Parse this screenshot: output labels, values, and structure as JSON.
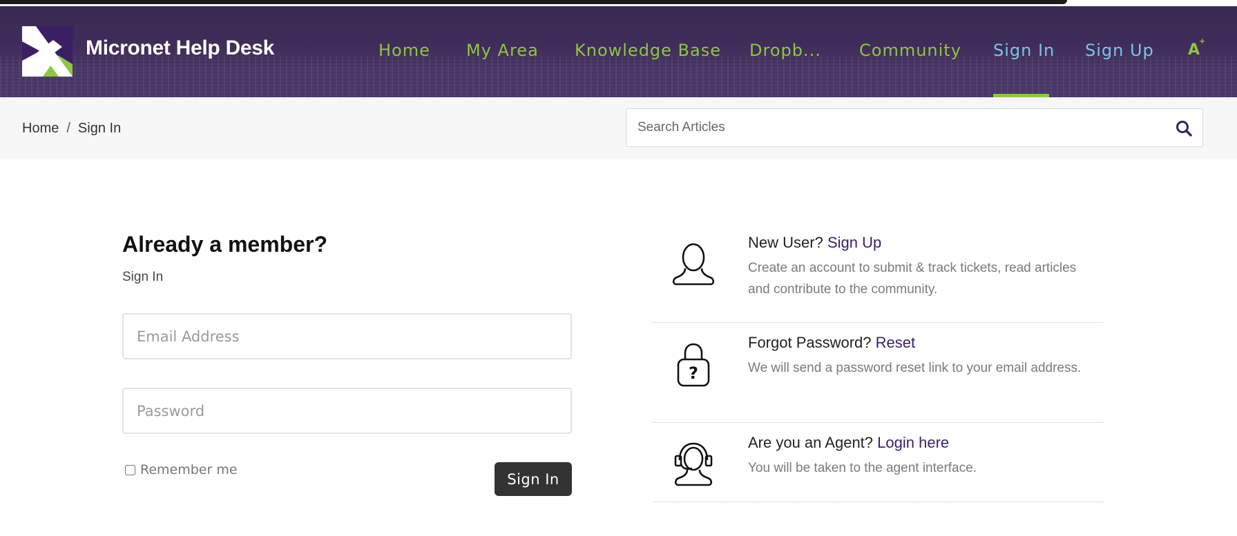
{
  "brand": {
    "name": "Micronet Help Desk"
  },
  "nav": {
    "items": [
      {
        "label": "Home",
        "color": "#8fc640"
      },
      {
        "label": "My Area",
        "color": "#8fc640"
      },
      {
        "label": "Knowledge Base",
        "color": "#8fc640"
      },
      {
        "label": "Dropb...",
        "color": "#8fc640"
      },
      {
        "label": "Community",
        "color": "#8fc640"
      },
      {
        "label": "Sign In",
        "color": "#7ec3e8",
        "active": true
      },
      {
        "label": "Sign Up",
        "color": "#7ec3e8"
      }
    ],
    "font_toggle": "A",
    "font_toggle_sup": "+"
  },
  "breadcrumb": {
    "home": "Home",
    "separator": "/",
    "current": "Sign In"
  },
  "search": {
    "placeholder": "Search Articles",
    "value": ""
  },
  "login": {
    "title": "Already a member?",
    "subtitle": "Sign In",
    "email_placeholder": "Email Address",
    "password_placeholder": "Password",
    "remember_label": "Remember me",
    "remember_checked": false,
    "submit_label": "Sign In"
  },
  "info": {
    "new_user": {
      "prefix": "New User?",
      "link": "Sign Up",
      "desc": "Create an account to submit & track tickets, read articles and contribute to the community.",
      "icon": "user-icon"
    },
    "forgot": {
      "prefix": "Forgot Password?",
      "link": "Reset",
      "desc": "We will send a password reset link to your email address.",
      "icon": "lock-question-icon"
    },
    "agent": {
      "prefix": "Are you an Agent?",
      "link": "Login here",
      "desc": "You will be taken to the agent interface.",
      "icon": "headset-agent-icon"
    }
  },
  "colors": {
    "header_bg": "#3f2d5a",
    "nav_green": "#8fc640",
    "nav_blue": "#7ec3e8",
    "link_purple": "#3a1f6b",
    "button_dark": "#333333"
  }
}
